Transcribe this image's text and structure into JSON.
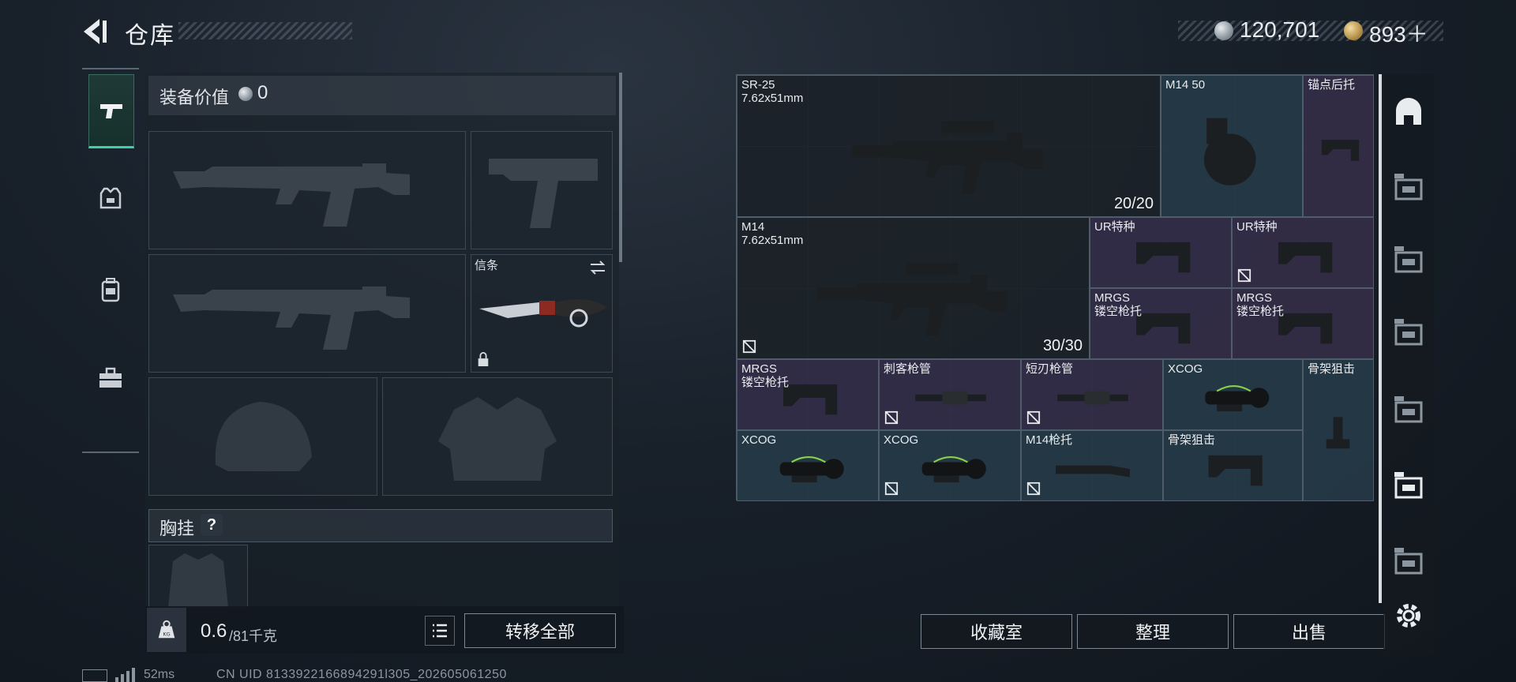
{
  "header": {
    "title": "仓库",
    "silver_amount": "120,701",
    "gold_amount": "893＋"
  },
  "left_nav": {
    "tabs": [
      {
        "name": "weapon-tab",
        "icon": "pistol-icon",
        "active": true
      },
      {
        "name": "armor-tab",
        "icon": "vest-icon",
        "active": false
      },
      {
        "name": "backpack-tab",
        "icon": "backpack-icon",
        "active": false
      },
      {
        "name": "toolbox-tab",
        "icon": "toolbox-icon",
        "active": false
      }
    ]
  },
  "equipment": {
    "value_label": "装备价值",
    "value": "0",
    "knife_label": "信条",
    "chest_rig_label": "胸挂",
    "chest_rig_help": "?",
    "weight_value": "0.6",
    "weight_max": "/81千克",
    "transfer_all": "转移全部"
  },
  "inventory": {
    "items": [
      {
        "name": "SR-25\n7.62x51mm",
        "count": "20/20",
        "color": "dark",
        "pic": "rifle"
      },
      {
        "name": "M14 50",
        "count": "",
        "color": "blue",
        "pic": "drum-mag"
      },
      {
        "name": "锚点后托",
        "count": "",
        "color": "purple",
        "pic": "stock-small"
      },
      {
        "name": "M14\n7.62x51mm",
        "count": "30/30",
        "color": "dark",
        "pic": "rifle2",
        "nodrop": true
      },
      {
        "name": "UR特种",
        "count": "",
        "color": "purple",
        "pic": "stock"
      },
      {
        "name": "UR特种",
        "count": "",
        "color": "purple",
        "pic": "stock",
        "nodrop": true
      },
      {
        "name": "MRGS\n镂空枪托",
        "count": "",
        "color": "purple",
        "pic": "stock"
      },
      {
        "name": "MRGS\n镂空枪托",
        "count": "",
        "color": "purple",
        "pic": "stock"
      },
      {
        "name": "MRGS\n镂空枪托",
        "count": "",
        "color": "purple",
        "pic": "stock"
      },
      {
        "name": "刺客枪管",
        "count": "",
        "color": "purple",
        "pic": "barrel",
        "nodrop": true
      },
      {
        "name": "短刃枪管",
        "count": "",
        "color": "purple",
        "pic": "barrel",
        "nodrop": true
      },
      {
        "name": "XCOG",
        "count": "",
        "color": "blue",
        "pic": "scope"
      },
      {
        "name": "骨架狙击",
        "count": "",
        "color": "blue",
        "pic": "stock-tall"
      },
      {
        "name": "XCOG",
        "count": "",
        "color": "blue",
        "pic": "scope"
      },
      {
        "name": "XCOG",
        "count": "",
        "color": "blue",
        "pic": "scope",
        "nodrop": true
      },
      {
        "name": "M14枪托",
        "count": "",
        "color": "blue",
        "pic": "wood-stock",
        "nodrop": true
      },
      {
        "name": "骨架狙击",
        "count": "",
        "color": "blue",
        "pic": "stock"
      }
    ],
    "actions": {
      "collection": "收藏室",
      "sort": "整理",
      "sell": "出售"
    }
  },
  "right_nav": {
    "tabs": [
      "helmet-icon",
      "tier-3-container-icon",
      "tier-3-container-icon",
      "tier-4-container-icon",
      "tier-4-medkit-icon",
      "tier-3-weapon-icon",
      "tier-4-ammo-icon"
    ]
  },
  "footer": {
    "ping": "52ms",
    "uid": "CN UID 8133922166894291l305_202605061250"
  },
  "colors": {
    "accent": "#3fd0a8",
    "blue_rarity": "#263a48",
    "purple_rarity": "#342e48"
  }
}
